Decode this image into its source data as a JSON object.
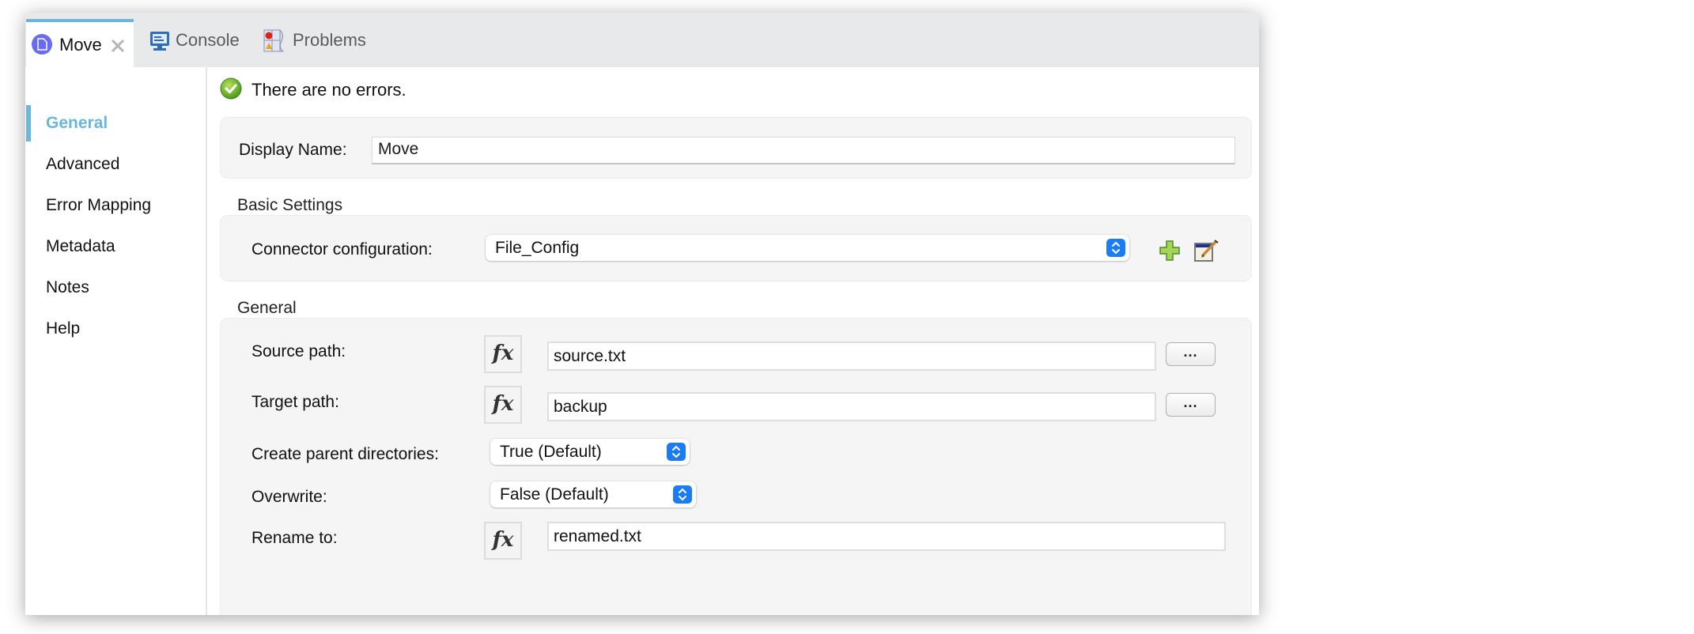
{
  "tabs": [
    {
      "label": "Move",
      "icon": "document-circle-icon",
      "active": true,
      "closable": true
    },
    {
      "label": "Console",
      "icon": "console-monitor-icon",
      "active": false
    },
    {
      "label": "Problems",
      "icon": "problems-icon",
      "active": false
    }
  ],
  "sidebar": {
    "items": [
      {
        "label": "General",
        "active": true
      },
      {
        "label": "Advanced"
      },
      {
        "label": "Error Mapping"
      },
      {
        "label": "Metadata"
      },
      {
        "label": "Notes"
      },
      {
        "label": "Help"
      }
    ]
  },
  "status": {
    "icon": "success-check-icon",
    "text": "There are no errors."
  },
  "display_name": {
    "label": "Display Name:",
    "value": "Move"
  },
  "basic_settings": {
    "title": "Basic Settings",
    "connector": {
      "label": "Connector configuration:",
      "value": "File_Config"
    }
  },
  "general": {
    "title": "General",
    "source_path": {
      "label": "Source path:",
      "value": "source.txt",
      "browse": "..."
    },
    "target_path": {
      "label": "Target path:",
      "value": "backup",
      "browse": "..."
    },
    "create_parent": {
      "label": "Create parent directories:",
      "value": "True (Default)"
    },
    "overwrite": {
      "label": "Overwrite:",
      "value": "False (Default)"
    },
    "rename_to": {
      "label": "Rename to:",
      "value": "renamed.txt"
    },
    "fx_label": "fx"
  },
  "colors": {
    "accent": "#6ab6dc",
    "select_stepper": "#1a7df5",
    "success": "#6bb62a"
  }
}
